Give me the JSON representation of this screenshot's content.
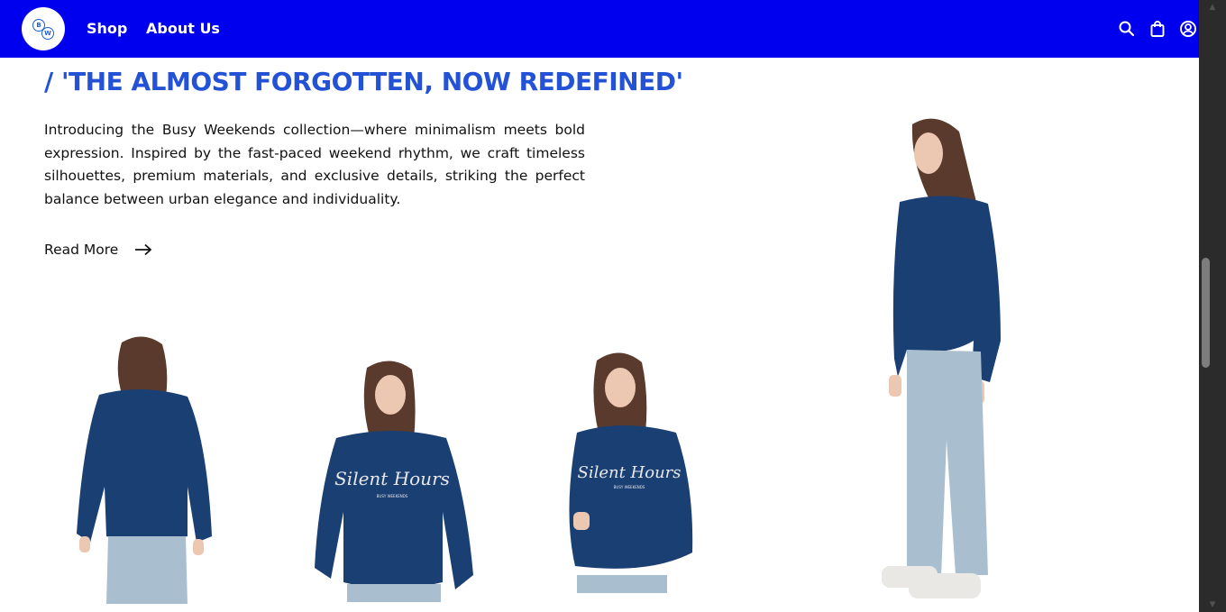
{
  "nav": {
    "logo_letters": [
      "B",
      "W"
    ],
    "links": [
      "Shop",
      "About Us"
    ],
    "icons": [
      "search-icon",
      "shopping-bag-icon",
      "user-account-icon"
    ],
    "background_color": "#0000ee"
  },
  "hero": {
    "headline": "/ 'THE ALMOST FORGOTTEN, NOW REDEFINED'",
    "headline_color": "#2452d6",
    "body": "Introducing the Busy Weekends collection—where minimalism meets bold expression. Inspired by the fast-paced weekend rhythm, we craft timeless silhouettes, premium materials, and exclusive details, striking the perfect balance between urban elegance and individuality.",
    "read_more_label": "Read More",
    "read_more_icon": "arrow-right-icon"
  },
  "gallery": {
    "sweatshirt_print": "Silent Hours",
    "sweatshirt_subprint": "BUSY WEEKENDS",
    "sweatshirt_color": "#1a3f73"
  }
}
